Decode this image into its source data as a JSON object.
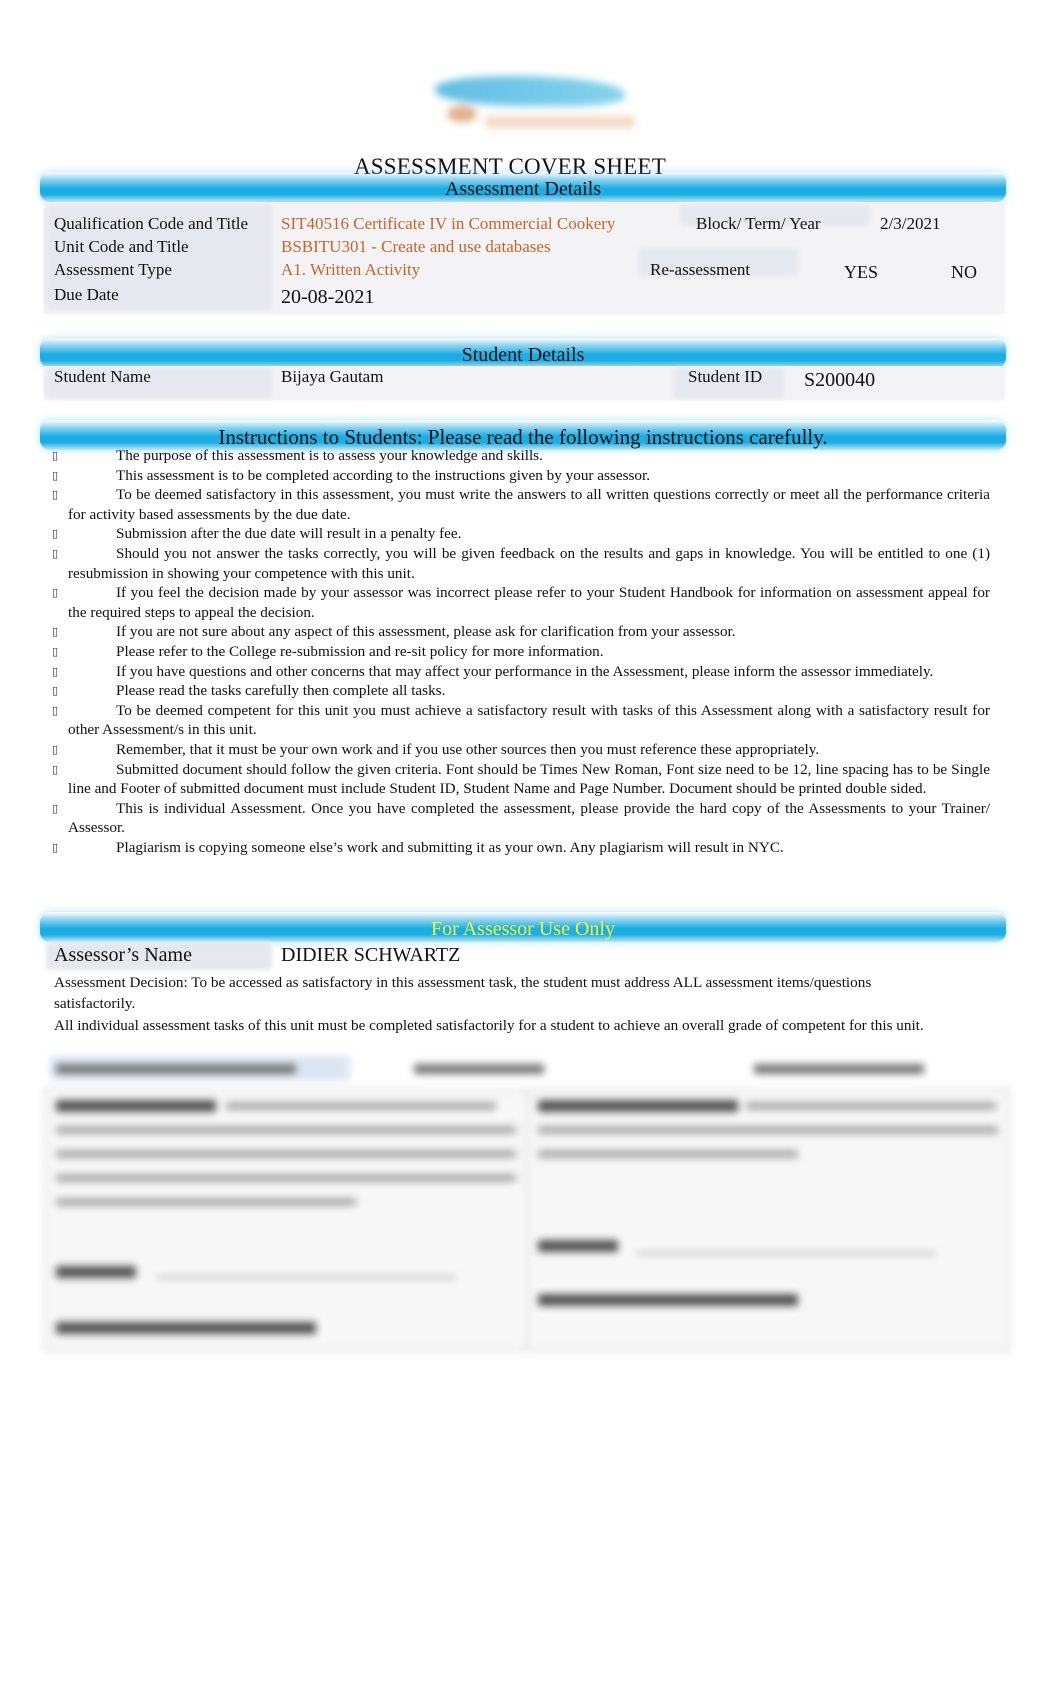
{
  "document": {
    "logo_name": "Skyline logo",
    "title": "ASSESSMENT COVER SHEET"
  },
  "assessment_details": {
    "heading": "Assessment Details",
    "qualification_label": "Qualification Code and Title",
    "qualification_value": "SIT40516 Certificate IV in Commercial Cookery",
    "block_label": "Block/ Term/ Year",
    "block_value": "2/3/2021",
    "unit_label": "Unit Code and Title",
    "unit_value": "BSBITU301 - Create and use databases",
    "type_label": "Assessment Type",
    "type_value": "A1. Written Activity",
    "reassessment_label": "Re-assessment",
    "reassessment_yes": "YES",
    "reassessment_no": "NO",
    "due_label": "Due Date",
    "due_value": "20-08-2021"
  },
  "student_details": {
    "heading": "Student Details",
    "name_label": "Student Name",
    "name_value": "Bijaya Gautam",
    "id_label": "Student ID",
    "id_value": "S200040"
  },
  "instructions": {
    "heading": "Instructions to Students:   Please read the following instructions carefully.",
    "bullet_glyph": "▯",
    "items": [
      "The purpose of this assessment is to assess your knowledge and skills.",
      "This assessment is to be completed according to the instructions given by your assessor.",
      "To be deemed satisfactory in this assessment, you must write the answers to all written questions correctly or meet all the performance criteria for activity based assessments by the due date.",
      "Submission after the due date will result in a penalty fee.",
      "Should you not answer the tasks correctly, you will be given feedback on the results and gaps in knowledge. You will be entitled to one (1) resubmission in showing your competence with this unit.",
      "If you feel the decision made by your assessor was incorrect please refer to your Student Handbook for information on assessment appeal for the required steps to appeal the decision.",
      "If you are not sure about any aspect of this assessment, please ask for clarification from your assessor.",
      "Please refer to the College re-submission and re-sit policy for more information.",
      "If you have questions and other concerns that may affect your performance in the Assessment, please inform the assessor immediately.",
      "Please read the tasks carefully then complete all tasks.",
      "To be deemed competent for this unit you must achieve a satisfactory result with tasks of this Assessment along with a satisfactory result for other Assessment/s in this unit.",
      "Remember, that it must be your own work and if you use other sources then you must reference these appropriately.",
      "Submitted document should follow the given criteria. Font should be Times New Roman, Font size need to be 12, line spacing has to be Single line and Footer of submitted document must include Student ID, Student Name and Page Number. Document should be printed double sided.",
      "This is individual Assessment. Once you have completed the assessment, please provide the hard copy of the Assessments to your Trainer/ Assessor.",
      "Plagiarism is copying someone else’s work and submitting it as your own. Any plagiarism will result in NYC."
    ]
  },
  "assessor": {
    "heading": "For Assessor Use Only",
    "name_label": "Assessor’s Name",
    "name_value": "DIDIER SCHWARTZ",
    "decision_text_1": "Assessment Decision: To be accessed as satisfactory in this assessment task, the student must address ALL assessment items/questions satisfactorily.",
    "decision_text_2": "All individual assessment tasks of this unit must be completed satisfactorily for a student to achieve an overall grade of competent for this unit."
  },
  "colors": {
    "band_blue": "#1aaee4",
    "value_orange": "#c8642a",
    "assessor_heading_yellow": "#f4f429"
  }
}
